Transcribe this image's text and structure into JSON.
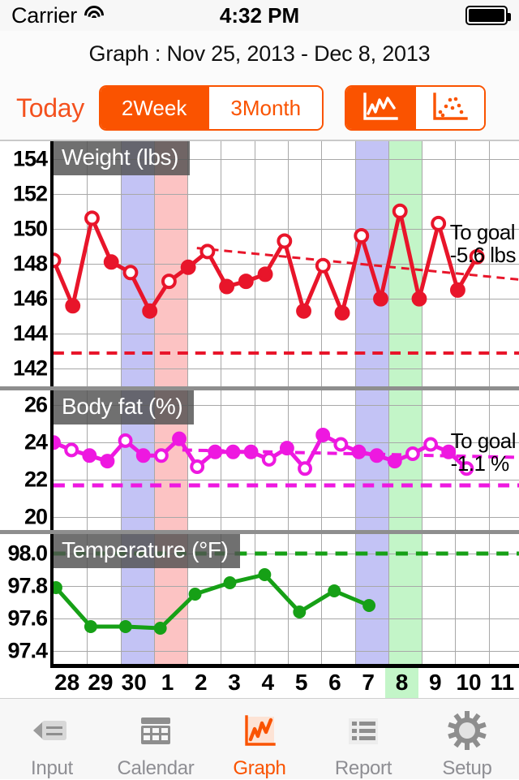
{
  "status_bar": {
    "carrier": "Carrier",
    "wifi_icon": "wifi-icon",
    "time": "4:32 PM",
    "battery_icon": "battery-icon"
  },
  "nav": {
    "title": "Graph : Nov 25, 2013 - Dec 8, 2013"
  },
  "controls": {
    "today_label": "Today",
    "range_segments": [
      {
        "label": "2Week",
        "selected": true
      },
      {
        "label": "3Month",
        "selected": false
      }
    ],
    "graph_type_segments": [
      {
        "icon": "line-chart-icon",
        "selected": true
      },
      {
        "icon": "scatter-chart-icon",
        "selected": false
      }
    ]
  },
  "accent_color": "#fa5300",
  "chart_data": [
    {
      "type": "line",
      "title": "Weight (lbs)",
      "ylabel": "Weight (lbs)",
      "xlabel": "",
      "ylim": [
        141,
        155
      ],
      "yticks": [
        154,
        152,
        150,
        148,
        146,
        144,
        142
      ],
      "grid": true,
      "color": "#e8152a",
      "goal_text_line1": "To goal",
      "goal_text_line2": "-5.6 lbs",
      "goal_line_value": 142.9,
      "categories": [
        "28",
        "29",
        "30",
        "1",
        "2",
        "3",
        "4",
        "5",
        "6",
        "7",
        "8",
        "9",
        "10",
        "11"
      ],
      "x": [
        27.72,
        28.05,
        28.4,
        28.72,
        29.05,
        29.38,
        29.72,
        30.05,
        30.38,
        30.72,
        31.05,
        31.38,
        31.72,
        32.05,
        32.38,
        32.72,
        33.05,
        33.38,
        33.72,
        34.05,
        34.4,
        34.72,
        35.05,
        35.4,
        35.72
      ],
      "values": [
        148.2,
        145.6,
        150.6,
        148.1,
        147.5,
        145.3,
        147.0,
        147.8,
        148.7,
        146.7,
        147.0,
        147.4,
        149.3,
        145.3,
        147.9,
        145.2,
        149.6,
        146.0,
        151.0,
        146.0,
        150.3,
        146.5,
        148.4
      ],
      "marker_filled": [
        false,
        true,
        false,
        true,
        false,
        true,
        false,
        true,
        false,
        true,
        true,
        true,
        false,
        true,
        false,
        true,
        false,
        true,
        false,
        true,
        false,
        true,
        false
      ],
      "trend_start": 148.9,
      "trend_end": 147.1
    },
    {
      "type": "line",
      "title": "Body fat (%)",
      "ylabel": "Body fat (%)",
      "xlabel": "",
      "ylim": [
        19.3,
        26.8
      ],
      "yticks": [
        26,
        24,
        22,
        20
      ],
      "grid": true,
      "color": "#ee18e0",
      "goal_text_line1": "To goal",
      "goal_text_line2": "-1.1 %",
      "goal_line_value": 21.7,
      "categories": [
        "28",
        "29",
        "30",
        "1",
        "2",
        "3",
        "4",
        "5",
        "6",
        "7",
        "8",
        "9",
        "10",
        "11"
      ],
      "values": [
        24.0,
        23.6,
        23.3,
        23.0,
        24.1,
        23.3,
        23.3,
        24.2,
        22.7,
        23.5,
        23.5,
        23.5,
        23.1,
        23.7,
        22.6,
        24.4,
        23.9,
        23.5,
        23.3,
        23.0,
        23.4,
        23.9,
        23.5,
        22.6
      ],
      "marker_filled": [
        true,
        false,
        true,
        true,
        false,
        true,
        false,
        true,
        false,
        true,
        true,
        true,
        false,
        true,
        false,
        true,
        false,
        true,
        true,
        true,
        false,
        false,
        true,
        false
      ],
      "trend_start": 23.6,
      "trend_end": 23.2
    },
    {
      "type": "line",
      "title": "Temperature (°F)",
      "ylabel": "Temperature (°F)",
      "xlabel": "",
      "ylim": [
        97.32,
        98.12
      ],
      "yticks": [
        "98.0",
        "97.8",
        "97.6",
        "97.4"
      ],
      "grid": true,
      "color": "#16a016",
      "goal_line_value": 98.0,
      "categories": [
        "28",
        "29",
        "30",
        "1",
        "2",
        "3",
        "4",
        "5",
        "6",
        "7",
        "8",
        "9",
        "10",
        "11"
      ],
      "values": [
        97.79,
        97.55,
        97.55,
        97.54,
        97.75,
        97.82,
        97.87,
        97.64,
        97.77,
        97.68
      ],
      "marker_filled": [
        true,
        true,
        true,
        true,
        true,
        true,
        true,
        true,
        true,
        true
      ]
    }
  ],
  "xaxis": {
    "labels": [
      "28",
      "29",
      "30",
      "1",
      "2",
      "3",
      "4",
      "5",
      "6",
      "7",
      "8",
      "9",
      "10",
      "11"
    ],
    "highlight_label": "8"
  },
  "highlight_bands": [
    {
      "label": "30",
      "color": "#c3c3f5",
      "name": "blue-band-nov30"
    },
    {
      "label": "1",
      "color": "#fcc3c3",
      "name": "pink-band-dec1"
    },
    {
      "label": "7",
      "color": "#c3c3f5",
      "name": "blue-band-dec7"
    },
    {
      "label": "8",
      "color": "#c3f5c8",
      "name": "green-band-dec8"
    }
  ],
  "tabbar": {
    "items": [
      {
        "label": "Input",
        "icon": "input-icon",
        "active": false
      },
      {
        "label": "Calendar",
        "icon": "calendar-icon",
        "active": false
      },
      {
        "label": "Graph",
        "icon": "graph-icon",
        "active": true
      },
      {
        "label": "Report",
        "icon": "report-icon",
        "active": false
      },
      {
        "label": "Setup",
        "icon": "gear-icon",
        "active": false
      }
    ]
  }
}
